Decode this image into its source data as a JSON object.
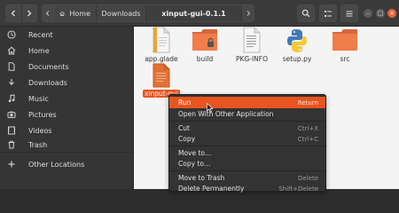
{
  "header": {
    "breadcrumbs": [
      "Home",
      "Downloads",
      "xinput-gui-0.1.1"
    ],
    "icons": {
      "back": "chevron-left-icon",
      "forward": "chevron-right-icon",
      "home": "home-icon",
      "search": "search-icon",
      "view": "view-options-icon",
      "menu": "hamburger-menu-icon",
      "minimize": "minimize-icon",
      "maximize": "maximize-icon",
      "close": "close-icon"
    }
  },
  "sidebar": {
    "items": [
      {
        "label": "Recent",
        "icon": "clock-icon"
      },
      {
        "label": "Home",
        "icon": "home-icon"
      },
      {
        "label": "Documents",
        "icon": "document-icon"
      },
      {
        "label": "Downloads",
        "icon": "download-icon"
      },
      {
        "label": "Music",
        "icon": "music-icon"
      },
      {
        "label": "Pictures",
        "icon": "camera-icon"
      },
      {
        "label": "Videos",
        "icon": "video-icon"
      },
      {
        "label": "Trash",
        "icon": "trash-icon"
      },
      {
        "label": "Other Locations",
        "icon": "plus-icon"
      }
    ]
  },
  "files": [
    {
      "name": "app.glade",
      "type": "document"
    },
    {
      "name": "build",
      "type": "folder-locked"
    },
    {
      "name": "PKG-INFO",
      "type": "text"
    },
    {
      "name": "setup.py",
      "type": "python"
    },
    {
      "name": "src",
      "type": "folder"
    },
    {
      "name": "xinput-gui",
      "type": "script",
      "selected": true
    }
  ],
  "context_menu": {
    "items": [
      {
        "label": "Run",
        "accel": "Return",
        "highlighted": true
      },
      {
        "label": "Open With Other Application",
        "accel": ""
      },
      {
        "label": "Cut",
        "accel": "Ctrl+X"
      },
      {
        "label": "Copy",
        "accel": "Ctrl+C"
      },
      {
        "label": "Move to…",
        "accel": ""
      },
      {
        "label": "Copy to…",
        "accel": ""
      },
      {
        "label": "Move to Trash",
        "accel": "Delete"
      },
      {
        "label": "Delete Permanently",
        "accel": "Shift+Delete"
      }
    ]
  },
  "colors": {
    "accent": "#e9541f",
    "folder": "#f07d4a",
    "sidebar_bg": "#353535",
    "content_bg": "#f4f4f4"
  }
}
